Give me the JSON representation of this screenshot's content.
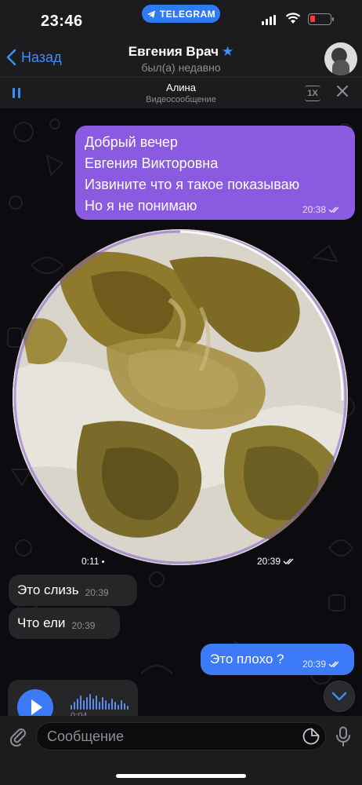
{
  "status_bar": {
    "time": "23:46",
    "app_indicator": "TELEGRAM",
    "battery_color": "#ff3b30"
  },
  "header": {
    "back_label": "Назад",
    "contact_name": "Евгения Врач",
    "contact_status": "был(а) недавно",
    "verified_icon": "star-icon"
  },
  "player": {
    "name": "Алина",
    "subtitle": "Видеосообщение",
    "speed": "1X"
  },
  "messages": {
    "outgoing_purple": {
      "lines": [
        "Добрый вечер",
        "Евгения Викторовна",
        "Извините что я такое показываю",
        "Но я не понимаю"
      ],
      "time": "20:38"
    },
    "video_message": {
      "duration": "0:11",
      "time": "20:39"
    },
    "incoming": [
      {
        "text": "Это слизь",
        "time": "20:39"
      },
      {
        "text": "Что ели",
        "time": "20:39"
      }
    ],
    "outgoing_blue": {
      "text": "Это плохо ?",
      "time": "20:39"
    },
    "voice": {
      "duration": "0:04"
    }
  },
  "input": {
    "placeholder": "Сообщение"
  },
  "colors": {
    "accent": "#3e8ef7",
    "outgoing_purple": "#8a5be0",
    "outgoing_blue": "#3d7af7",
    "incoming": "#262628"
  }
}
